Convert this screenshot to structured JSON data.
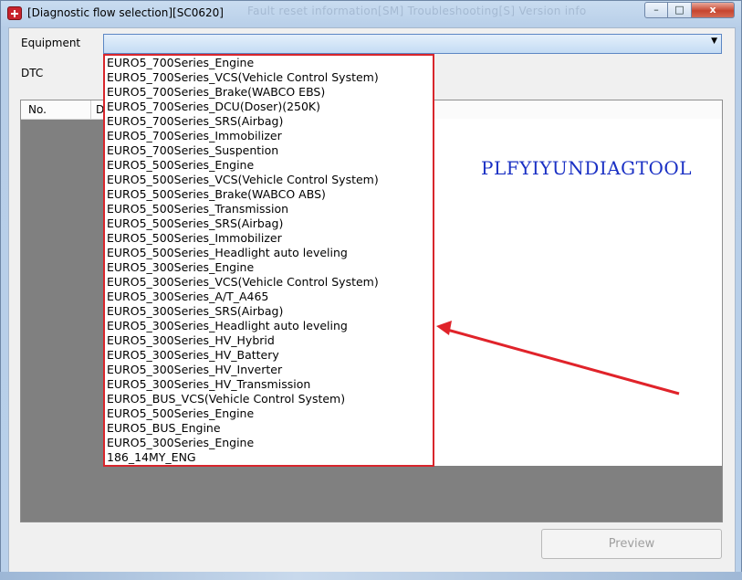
{
  "window": {
    "title": "[Diagnostic flow selection][SC0620]",
    "background_title_text": "Fault reset information[SM]     Troubleshooting[S]     Version info",
    "minimize": "–",
    "maximize": "□",
    "close": "x"
  },
  "form": {
    "equipment_label": "Equipment",
    "dtc_label": "DTC",
    "equipment_value": ""
  },
  "table": {
    "col_no": "No.",
    "col_d": "D"
  },
  "dropdown": {
    "items": [
      "EURO5_700Series_Engine",
      "EURO5_700Series_VCS(Vehicle Control System)",
      "EURO5_700Series_Brake(WABCO EBS)",
      "EURO5_700Series_DCU(Doser)(250K)",
      "EURO5_700Series_SRS(Airbag)",
      "EURO5_700Series_Immobilizer",
      "EURO5_700Series_Suspention",
      "EURO5_500Series_Engine",
      "EURO5_500Series_VCS(Vehicle Control System)",
      "EURO5_500Series_Brake(WABCO ABS)",
      "EURO5_500Series_Transmission",
      "EURO5_500Series_SRS(Airbag)",
      "EURO5_500Series_Immobilizer",
      "EURO5_500Series_Headlight auto leveling",
      "EURO5_300Series_Engine",
      "EURO5_300Series_VCS(Vehicle Control System)",
      "EURO5_300Series_A/T_A465",
      "EURO5_300Series_SRS(Airbag)",
      "EURO5_300Series_Headlight auto leveling",
      "EURO5_300Series_HV_Hybrid",
      "EURO5_300Series_HV_Battery",
      "EURO5_300Series_HV_Inverter",
      "EURO5_300Series_HV_Transmission",
      "EURO5_BUS_VCS(Vehicle Control System)",
      "EURO5_500Series_Engine",
      "EURO5_BUS_Engine",
      "EURO5_300Series_Engine",
      "186_14MY_ENG"
    ]
  },
  "watermark": "PLFYIYUNDIAGTOOL",
  "buttons": {
    "preview": "Preview"
  },
  "colors": {
    "annotation_red": "#e0232a",
    "watermark_blue": "#1a30c4"
  },
  "icons": {
    "app": "app-icon",
    "combo": "chevron-down-icon",
    "annotation": "red-arrow-annotation"
  }
}
